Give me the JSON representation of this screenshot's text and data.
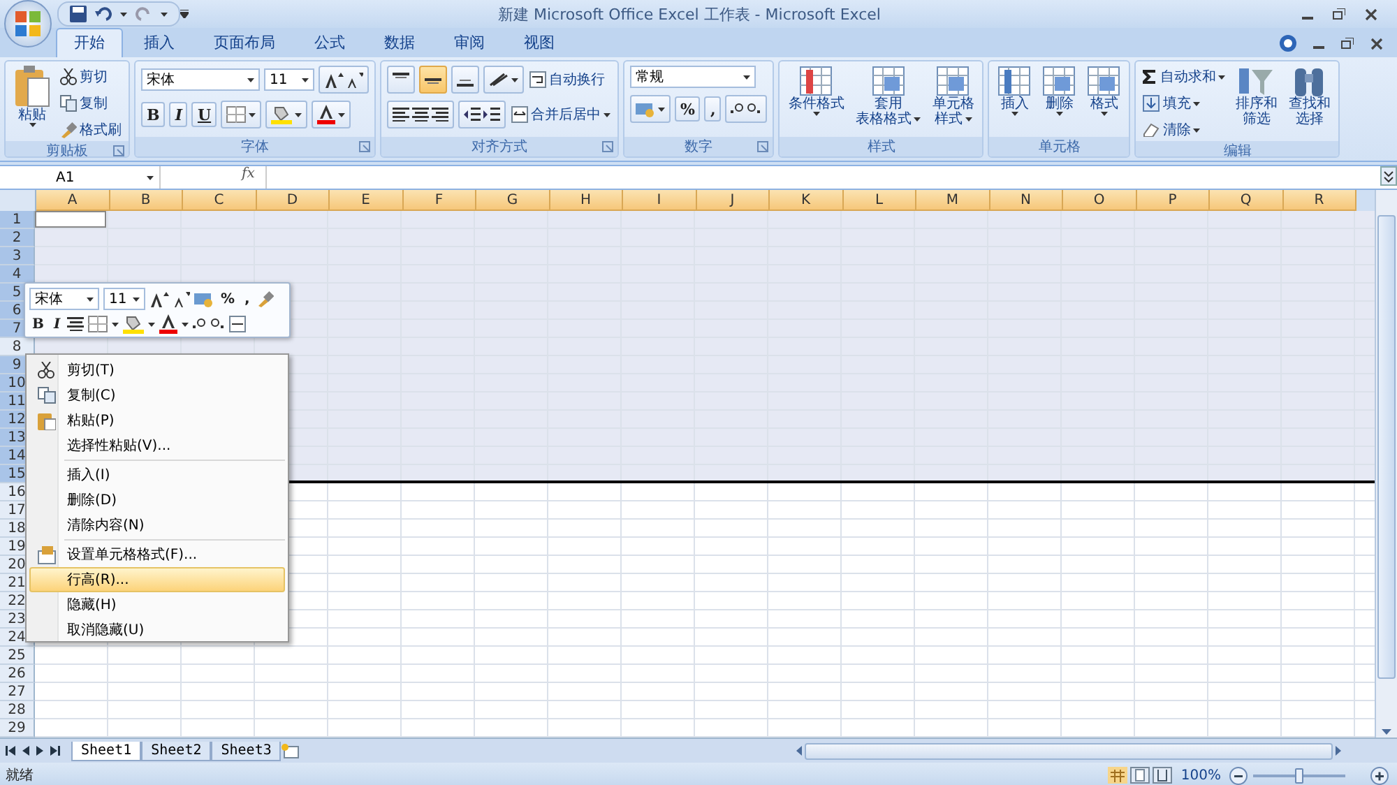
{
  "window": {
    "title": "新建 Microsoft Office Excel 工作表 - Microsoft Excel"
  },
  "tabs": [
    {
      "label": "开始",
      "selected": true
    },
    {
      "label": "插入",
      "selected": false
    },
    {
      "label": "页面布局",
      "selected": false
    },
    {
      "label": "公式",
      "selected": false
    },
    {
      "label": "数据",
      "selected": false
    },
    {
      "label": "审阅",
      "selected": false
    },
    {
      "label": "视图",
      "selected": false
    }
  ],
  "ribbon": [
    {
      "kind": "clipboard",
      "title": "剪贴板",
      "big": "粘贴",
      "small": [
        "剪切",
        "复制",
        "格式刷"
      ]
    },
    {
      "kind": "font",
      "title": "字体",
      "font": "宋体",
      "size": "11",
      "buttons": [
        "B",
        "I",
        "U"
      ]
    },
    {
      "kind": "alignment",
      "title": "对齐方式",
      "valign": [
        {
          "selected": false
        },
        {
          "selected": true
        },
        {
          "selected": false
        }
      ],
      "wrap": "自动换行",
      "merge": "合并后居中"
    },
    {
      "kind": "number",
      "title": "数字",
      "format": "常规",
      "buttons": [
        "%",
        ","
      ]
    },
    {
      "kind": "large",
      "title": "样式",
      "buttons": [
        {
          "lines": [
            "条件格式"
          ]
        },
        {
          "lines": [
            "套用",
            "表格格式"
          ]
        },
        {
          "lines": [
            "单元格",
            "样式"
          ]
        }
      ]
    },
    {
      "kind": "large",
      "title": "单元格",
      "buttons": [
        {
          "lines": [
            "插入"
          ]
        },
        {
          "lines": [
            "删除"
          ]
        },
        {
          "lines": [
            "格式"
          ]
        }
      ]
    },
    {
      "kind": "editing",
      "title": "编辑",
      "small": [
        "自动求和",
        "填充",
        "清除"
      ],
      "large": [
        {
          "lines": [
            "排序和",
            "筛选"
          ]
        },
        {
          "lines": [
            "查找和",
            "选择"
          ]
        }
      ]
    }
  ],
  "formula_bar": {
    "name_box": "A1",
    "function_label": "fx"
  },
  "columns": [
    "A",
    "B",
    "C",
    "D",
    "E",
    "F",
    "G",
    "H",
    "I",
    "J",
    "K",
    "L",
    "M",
    "N",
    "O",
    "P",
    "Q",
    "R"
  ],
  "rows": [
    {
      "label": "1",
      "selected": true
    },
    {
      "label": "2",
      "selected": true
    },
    {
      "label": "3",
      "selected": true
    },
    {
      "label": "4",
      "selected": true
    },
    {
      "label": "5",
      "selected": true
    },
    {
      "label": "6",
      "selected": true
    },
    {
      "label": "7",
      "selected": true
    },
    {
      "label": "8",
      "selected": false
    },
    {
      "label": "9",
      "selected": true
    },
    {
      "label": "10",
      "selected": true
    },
    {
      "label": "11",
      "selected": true
    },
    {
      "label": "12",
      "selected": true
    },
    {
      "label": "13",
      "selected": true
    },
    {
      "label": "14",
      "selected": true
    },
    {
      "label": "15",
      "selected": true
    },
    {
      "label": "16",
      "selected": false
    },
    {
      "label": "17",
      "selected": false
    },
    {
      "label": "18",
      "selected": false
    },
    {
      "label": "19",
      "selected": false
    },
    {
      "label": "20",
      "selected": false
    },
    {
      "label": "21",
      "selected": false
    },
    {
      "label": "22",
      "selected": false
    },
    {
      "label": "23",
      "selected": false
    },
    {
      "label": "24",
      "selected": false
    },
    {
      "label": "25",
      "selected": false
    },
    {
      "label": "26",
      "selected": false
    },
    {
      "label": "27",
      "selected": false
    },
    {
      "label": "28",
      "selected": false
    },
    {
      "label": "29",
      "selected": false
    }
  ],
  "mini_toolbar": {
    "font": "宋体",
    "size": "11",
    "percent": "%",
    "comma": ",",
    "bold": "B",
    "italic": "I"
  },
  "context_menu": [
    {
      "label": "剪切(T)",
      "separator_before": false,
      "selected": false
    },
    {
      "label": "复制(C)",
      "separator_before": false,
      "selected": false
    },
    {
      "label": "粘贴(P)",
      "separator_before": false,
      "selected": false
    },
    {
      "label": "选择性粘贴(V)...",
      "separator_before": false,
      "selected": false
    },
    {
      "label": "插入(I)",
      "separator_before": true,
      "selected": false
    },
    {
      "label": "删除(D)",
      "separator_before": false,
      "selected": false
    },
    {
      "label": "清除内容(N)",
      "separator_before": false,
      "selected": false
    },
    {
      "label": "设置单元格格式(F)...",
      "separator_before": true,
      "selected": false
    },
    {
      "label": "行高(R)...",
      "separator_before": false,
      "selected": true
    },
    {
      "label": "隐藏(H)",
      "separator_before": false,
      "selected": false
    },
    {
      "label": "取消隐藏(U)",
      "separator_before": false,
      "selected": false
    }
  ],
  "sheet_tabs": [
    {
      "label": "Sheet1",
      "selected": true
    },
    {
      "label": "Sheet2",
      "selected": false
    },
    {
      "label": "Sheet3",
      "selected": false
    }
  ],
  "status_bar": {
    "text": "就绪",
    "zoom": "100%",
    "zoom_level": {
      "level": 0.5
    }
  }
}
